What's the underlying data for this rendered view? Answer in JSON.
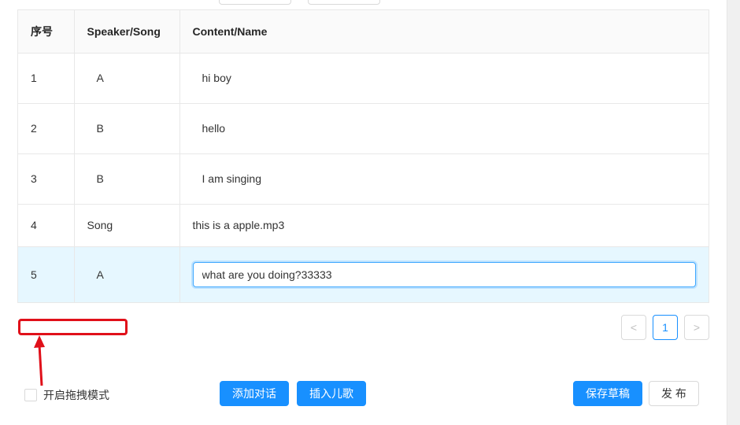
{
  "table": {
    "headers": {
      "index": "序号",
      "speaker": "Speaker/Song",
      "content": "Content/Name"
    },
    "rows": [
      {
        "index": "1",
        "speaker": "A",
        "content": "hi boy"
      },
      {
        "index": "2",
        "speaker": "B",
        "content": "hello"
      },
      {
        "index": "3",
        "speaker": "B",
        "content": "I am singing"
      },
      {
        "index": "4",
        "speaker": "Song",
        "content": "this is a apple.mp3"
      },
      {
        "index": "5",
        "speaker": "A",
        "content": "what are you doing?33333"
      }
    ]
  },
  "pagination": {
    "prev": "<",
    "current": "1",
    "next": ">"
  },
  "drag_mode": {
    "label": "开启拖拽模式",
    "checked": false
  },
  "buttons": {
    "add_dialogue": "添加对话",
    "insert_song": "插入儿歌",
    "save_draft": "保存草稿",
    "publish": "发 布"
  },
  "colors": {
    "primary": "#1890ff",
    "selected_row": "#e6f7ff",
    "annotation": "#e0101a"
  }
}
